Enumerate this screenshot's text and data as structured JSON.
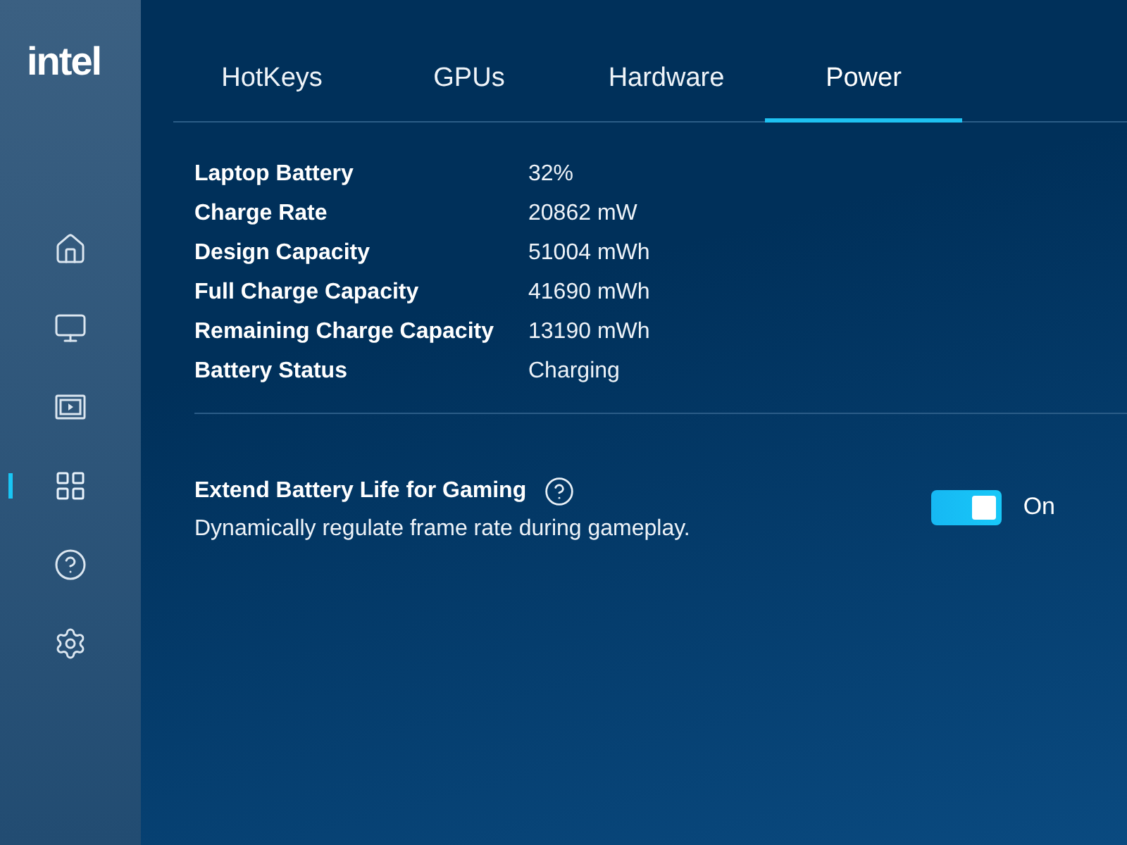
{
  "sidebar": {
    "logo": "intel",
    "items": [
      {
        "selected": false
      },
      {
        "selected": false
      },
      {
        "selected": false
      },
      {
        "selected": true
      },
      {
        "selected": false
      },
      {
        "selected": false
      }
    ]
  },
  "tabs": [
    {
      "label": "HotKeys",
      "selected": false
    },
    {
      "label": "GPUs",
      "selected": false
    },
    {
      "label": "Hardware",
      "selected": false
    },
    {
      "label": "Power",
      "selected": true
    }
  ],
  "battery_info": [
    {
      "label": "Laptop Battery",
      "value": "32%"
    },
    {
      "label": "Charge Rate",
      "value": "20862 mW"
    },
    {
      "label": "Design Capacity",
      "value": "51004 mWh"
    },
    {
      "label": "Full Charge Capacity",
      "value": "41690 mWh"
    },
    {
      "label": "Remaining Charge Capacity",
      "value": "13190 mWh"
    },
    {
      "label": "Battery Status",
      "value": "Charging"
    }
  ],
  "setting": {
    "title": "Extend Battery Life for Gaming",
    "description": "Dynamically regulate frame rate during gameplay.",
    "on": true,
    "state_label": "On"
  }
}
